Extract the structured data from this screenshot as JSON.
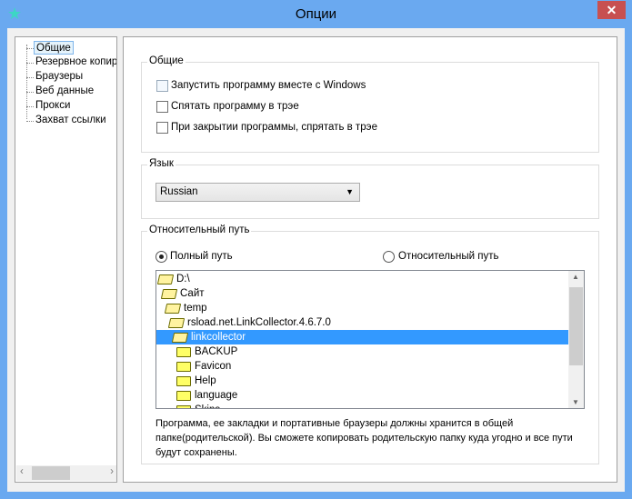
{
  "window": {
    "title": "Опции",
    "close": "✕",
    "icon": "star-icon"
  },
  "nav": {
    "items": [
      "Общие",
      "Резервное копирование",
      "Браузеры",
      "Веб данные",
      "Прокси",
      "Захват ссылки"
    ],
    "selected": 0,
    "scroll_left": "‹",
    "scroll_right": "›"
  },
  "general": {
    "legend": "Общие",
    "options": [
      {
        "label": "Запустить программу вместе с Windows",
        "checked": false
      },
      {
        "label": "Спятать программу в трэе",
        "checked": false
      },
      {
        "label": "При закрытии программы, спрятать в трэе",
        "checked": false
      }
    ]
  },
  "language": {
    "legend": "Язык",
    "value": "Russian",
    "arrow": "▼"
  },
  "path": {
    "legend": "Относительный путь",
    "full_label": "Полный путь",
    "relative_label": "Относительный путь",
    "selected": "full",
    "folders": [
      {
        "name": "D:\\",
        "open": true
      },
      {
        "name": "Сайт",
        "open": true
      },
      {
        "name": "temp",
        "open": true
      },
      {
        "name": "rsload.net.LinkCollector.4.6.7.0",
        "open": true
      },
      {
        "name": "linkcollector",
        "open": true,
        "selected": true
      },
      {
        "name": "BACKUP",
        "open": false
      },
      {
        "name": "Favicon",
        "open": false
      },
      {
        "name": "Help",
        "open": false
      },
      {
        "name": "language",
        "open": false
      },
      {
        "name": "Skins",
        "open": false
      }
    ],
    "scroll_up": "▲",
    "scroll_down": "▼",
    "note": "Программа, ее закладки и портативные браузеры должны хранится в общей папке(родительской). Вы сможете копировать родительскую папку куда угодно и все пути будут сохранены."
  }
}
